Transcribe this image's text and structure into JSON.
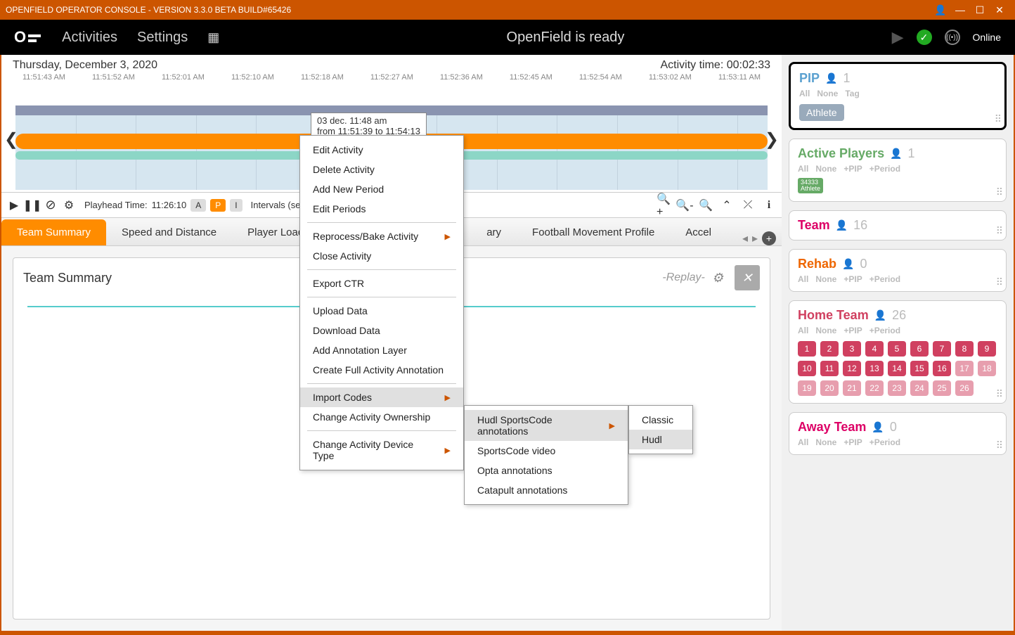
{
  "titlebar": {
    "text": "OPENFIELD OPERATOR CONSOLE - VERSION 3.3.0 BETA BUILD#65426"
  },
  "topnav": {
    "logo": "OF",
    "items": [
      "Activities",
      "Settings"
    ],
    "status": "OpenField is ready",
    "online": "Online"
  },
  "timeline": {
    "date": "Thursday, December 3, 2020",
    "activity_time_label": "Activity time:",
    "activity_time": "00:02:33",
    "ticks": [
      "11:51:43 AM",
      "11:51:52 AM",
      "11:52:01 AM",
      "11:52:10 AM",
      "11:52:18 AM",
      "11:52:27 AM",
      "11:52:36 AM",
      "11:52:45 AM",
      "11:52:54 AM",
      "11:53:02 AM",
      "11:53:11 AM"
    ],
    "tooltip_line1": "03 dec. 11:48 am",
    "tooltip_line2": "from 11:51:39 to 11:54:13"
  },
  "controls": {
    "playhead_label": "Playhead Time:",
    "playhead_value": "11:26:10",
    "btn_a": "A",
    "btn_p": "P",
    "btn_i": "I",
    "intervals": "Intervals (sec)"
  },
  "tabs": [
    "Team Summary",
    "Speed and Distance",
    "Player Load",
    "ary",
    "Football Movement Profile",
    "Accel"
  ],
  "panel": {
    "title": "Team Summary",
    "replay": "-Replay-"
  },
  "context_menu": {
    "items": [
      {
        "label": "Edit Activity"
      },
      {
        "label": "Delete Activity"
      },
      {
        "label": "Add New Period"
      },
      {
        "label": "Edit Periods"
      },
      {
        "sep": true
      },
      {
        "label": "Reprocess/Bake Activity",
        "sub": true
      },
      {
        "label": "Close Activity"
      },
      {
        "sep": true
      },
      {
        "label": "Export CTR"
      },
      {
        "sep": true
      },
      {
        "label": "Upload Data"
      },
      {
        "label": "Download Data"
      },
      {
        "label": "Add Annotation Layer"
      },
      {
        "label": "Create Full Activity Annotation"
      },
      {
        "sep": true
      },
      {
        "label": "Import Codes",
        "sub": true,
        "hl": true
      },
      {
        "label": "Change Activity Ownership"
      },
      {
        "sep": true
      },
      {
        "label": "Change Activity Device Type",
        "sub": true
      }
    ],
    "submenu2": [
      {
        "label": "Hudl SportsCode annotations",
        "sub": true,
        "hl": true
      },
      {
        "label": "SportsCode video"
      },
      {
        "label": "Opta annotations"
      },
      {
        "label": "Catapult annotations"
      }
    ],
    "submenu3": [
      {
        "label": "Classic"
      },
      {
        "label": "Hudl",
        "hl": true
      }
    ]
  },
  "sidebar": {
    "pip": {
      "title": "PIP",
      "count": "1",
      "filters": [
        "All",
        "None",
        "Tag"
      ],
      "pill": "Athlete"
    },
    "active": {
      "title": "Active Players",
      "count": "1",
      "filters": [
        "All",
        "None",
        "+PIP",
        "+Period"
      ],
      "badge_num": "34333",
      "badge_txt": "Athlete"
    },
    "team": {
      "title": "Team",
      "count": "16"
    },
    "rehab": {
      "title": "Rehab",
      "count": "0",
      "filters": [
        "All",
        "None",
        "+PIP",
        "+Period"
      ]
    },
    "home": {
      "title": "Home Team",
      "count": "26",
      "filters": [
        "All",
        "None",
        "+PIP",
        "+Period"
      ],
      "numbers": [
        1,
        2,
        3,
        4,
        5,
        6,
        7,
        8,
        9,
        10,
        11,
        12,
        13,
        14,
        15,
        16,
        17,
        18,
        19,
        20,
        21,
        22,
        23,
        24,
        25,
        26
      ]
    },
    "away": {
      "title": "Away Team",
      "count": "0",
      "filters": [
        "All",
        "None",
        "+PIP",
        "+Period"
      ]
    }
  }
}
